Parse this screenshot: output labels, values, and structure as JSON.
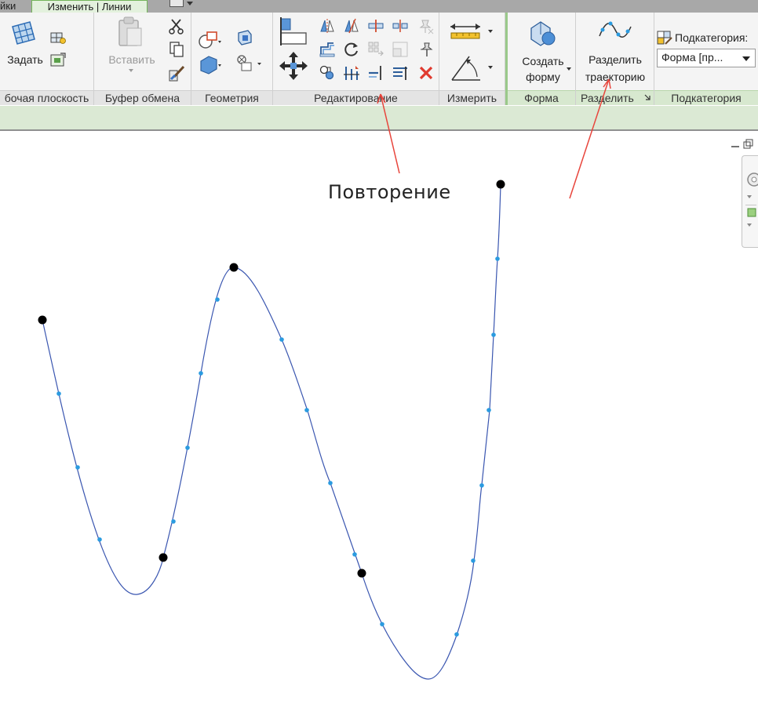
{
  "tabs": {
    "prev_label": "йки",
    "active_label": "Изменить | Линии"
  },
  "ribbon": {
    "workplane": {
      "set_label": "Задать",
      "panel_label": "бочая плоскость"
    },
    "clipboard": {
      "paste_label": "Вставить",
      "panel_label": "Буфер обмена"
    },
    "geometry": {
      "panel_label": "Геометрия"
    },
    "modify": {
      "panel_label": "Редактирование"
    },
    "measure": {
      "panel_label": "Измерить"
    },
    "form": {
      "create_line1": "Создать",
      "create_line2": "форму",
      "panel_label": "Форма"
    },
    "divide": {
      "btn_line1": "Разделить",
      "btn_line2": "траекторию",
      "panel_label": "Разделить"
    },
    "subcategory": {
      "title": "Подкатегория:",
      "value": "Форма [пр...",
      "panel_label": "Подкатегория"
    }
  },
  "annotation": {
    "text": "Повторение",
    "arrow_color": "#e8453c"
  },
  "colors": {
    "curve": "#3a56b0",
    "division_point": "#2a9be0",
    "control_point": "#000000",
    "ribbon_accent": "#73b45a"
  }
}
